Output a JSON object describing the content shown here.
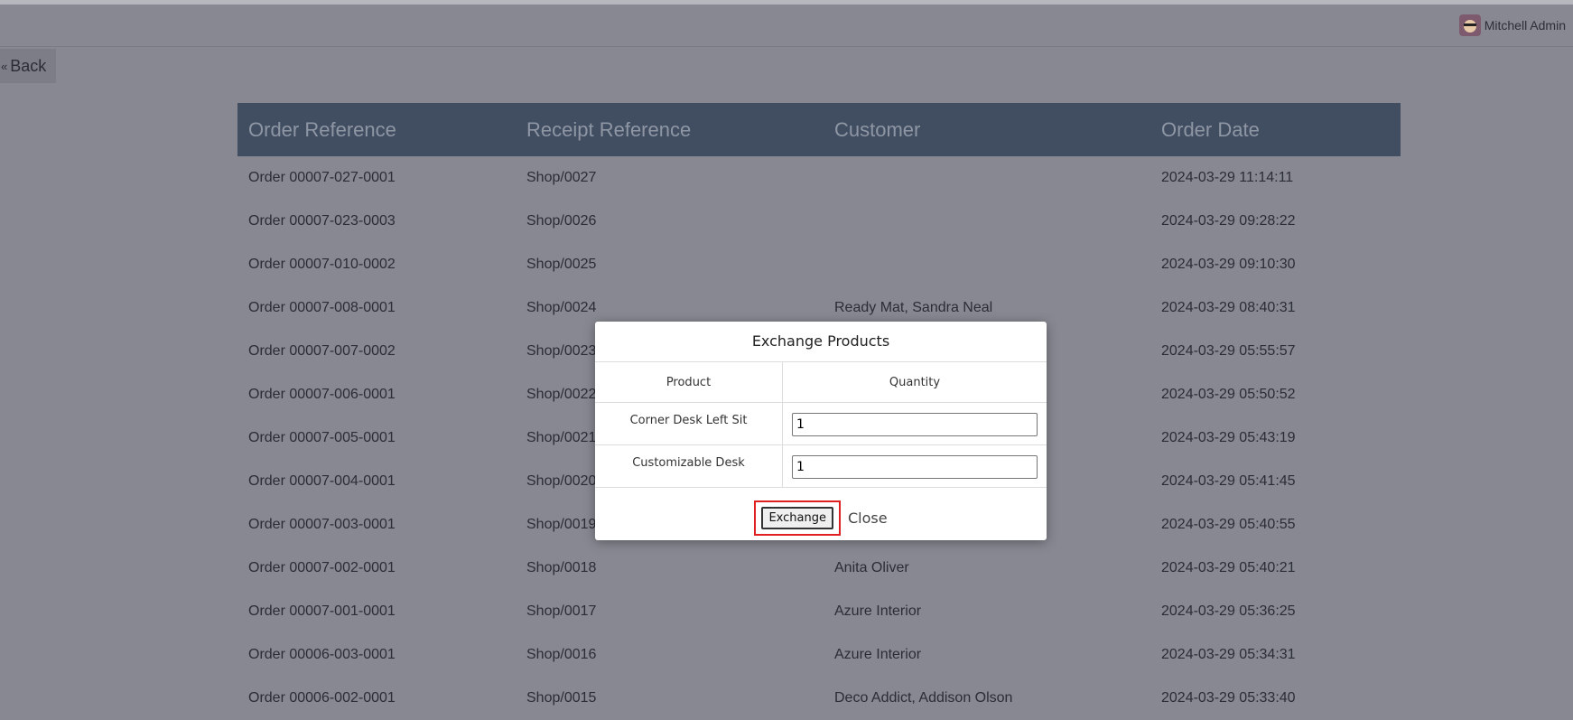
{
  "header": {
    "user_name": "Mitchell Admin"
  },
  "back": {
    "label": "Back",
    "icon": "double-chevron-left-icon"
  },
  "orders_table": {
    "columns": [
      "Order Reference",
      "Receipt Reference",
      "Customer",
      "Order Date"
    ],
    "rows": [
      [
        "Order 00007-027-0001",
        "Shop/0027",
        "",
        "2024-03-29 11:14:11"
      ],
      [
        "Order 00007-023-0003",
        "Shop/0026",
        "",
        "2024-03-29 09:28:22"
      ],
      [
        "Order 00007-010-0002",
        "Shop/0025",
        "",
        "2024-03-29 09:10:30"
      ],
      [
        "Order 00007-008-0001",
        "Shop/0024",
        "Ready Mat, Sandra Neal",
        "2024-03-29 08:40:31"
      ],
      [
        "Order 00007-007-0002",
        "Shop/0023",
        "",
        "2024-03-29 05:55:57"
      ],
      [
        "Order 00007-006-0001",
        "Shop/0022",
        "",
        "2024-03-29 05:50:52"
      ],
      [
        "Order 00007-005-0001",
        "Shop/0021",
        "",
        "2024-03-29 05:43:19"
      ],
      [
        "Order 00007-004-0001",
        "Shop/0020",
        "",
        "2024-03-29 05:41:45"
      ],
      [
        "Order 00007-003-0001",
        "Shop/0019",
        "",
        "2024-03-29 05:40:55"
      ],
      [
        "Order 00007-002-0001",
        "Shop/0018",
        "Anita Oliver",
        "2024-03-29 05:40:21"
      ],
      [
        "Order 00007-001-0001",
        "Shop/0017",
        "Azure Interior",
        "2024-03-29 05:36:25"
      ],
      [
        "Order 00006-003-0001",
        "Shop/0016",
        "Azure Interior",
        "2024-03-29 05:34:31"
      ],
      [
        "Order 00006-002-0001",
        "Shop/0015",
        "Deco Addict, Addison Olson",
        "2024-03-29 05:33:40"
      ]
    ]
  },
  "modal": {
    "title": "Exchange Products",
    "col_product": "Product",
    "col_quantity": "Quantity",
    "items": [
      {
        "product": "Corner Desk Left Sit",
        "quantity": "1"
      },
      {
        "product": "Customizable Desk",
        "quantity": "1"
      }
    ],
    "exchange_label": "Exchange",
    "close_label": "Close"
  }
}
